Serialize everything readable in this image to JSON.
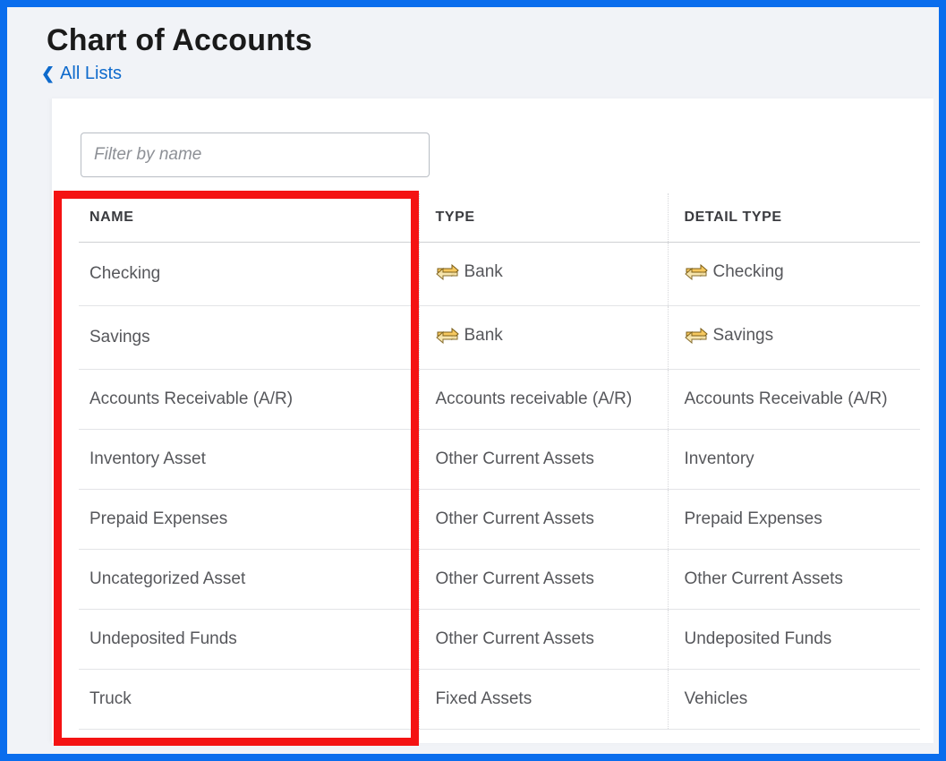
{
  "header": {
    "title": "Chart of Accounts",
    "breadcrumb_label": "All Lists"
  },
  "filter": {
    "placeholder": "Filter by name",
    "value": ""
  },
  "table": {
    "columns": [
      "NAME",
      "TYPE",
      "DETAIL TYPE"
    ],
    "rows": [
      {
        "name": "Checking",
        "type": "Bank",
        "type_icon": true,
        "detail": "Checking",
        "detail_icon": true
      },
      {
        "name": "Savings",
        "type": "Bank",
        "type_icon": true,
        "detail": "Savings",
        "detail_icon": true
      },
      {
        "name": "Accounts Receivable (A/R)",
        "type": "Accounts receivable (A/R)",
        "type_icon": false,
        "detail": "Accounts Receivable (A/R)",
        "detail_icon": false
      },
      {
        "name": "Inventory Asset",
        "type": "Other Current Assets",
        "type_icon": false,
        "detail": "Inventory",
        "detail_icon": false
      },
      {
        "name": "Prepaid Expenses",
        "type": "Other Current Assets",
        "type_icon": false,
        "detail": "Prepaid Expenses",
        "detail_icon": false
      },
      {
        "name": "Uncategorized Asset",
        "type": "Other Current Assets",
        "type_icon": false,
        "detail": "Other Current Assets",
        "detail_icon": false
      },
      {
        "name": "Undeposited Funds",
        "type": "Other Current Assets",
        "type_icon": false,
        "detail": "Undeposited Funds",
        "detail_icon": false
      },
      {
        "name": "Truck",
        "type": "Fixed Assets",
        "type_icon": false,
        "detail": "Vehicles",
        "detail_icon": false
      }
    ]
  }
}
